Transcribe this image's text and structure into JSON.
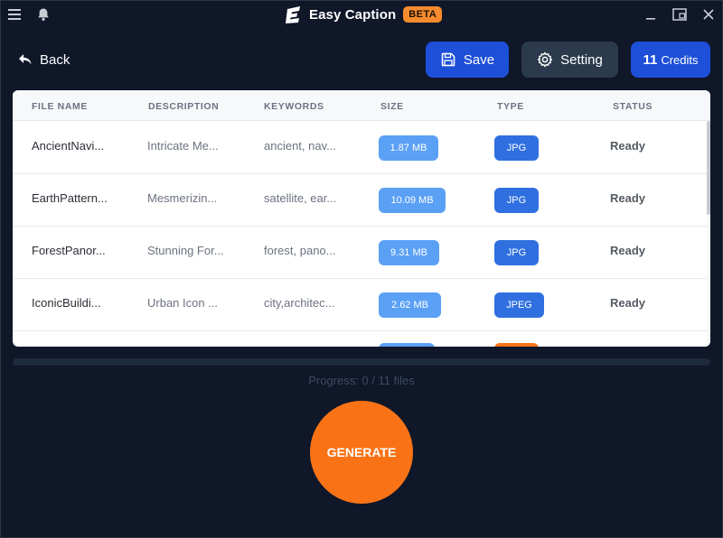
{
  "app": {
    "name": "Easy Caption",
    "badge": "BETA"
  },
  "colors": {
    "background": "#0f1729",
    "primary": "#1d4fd8",
    "accent": "#f97316",
    "secondary_button": "#2c3a4d",
    "size_pill": "#5aa0f5",
    "type_pill": "#2f6fe0"
  },
  "titlebar": {
    "menu_icon": "hamburger-icon",
    "notify_icon": "bell-icon",
    "window_controls": [
      "minimize-icon",
      "restore-icon",
      "close-icon"
    ]
  },
  "toolbar": {
    "back_label": "Back",
    "save_label": "Save",
    "setting_label": "Setting",
    "credits_count": "11",
    "credits_label": "Credits"
  },
  "table": {
    "columns": [
      "FILE NAME",
      "DESCRIPTION",
      "KEYWORDS",
      "SIZE",
      "TYPE",
      "STATUS"
    ],
    "rows": [
      {
        "file_name": "AncientNavi...",
        "description": "Intricate Me...",
        "keywords": "ancient, nav...",
        "size": "1.87 MB",
        "type": "JPG",
        "status": "Ready"
      },
      {
        "file_name": "EarthPattern...",
        "description": "Mesmerizin...",
        "keywords": "satellite, ear...",
        "size": "10.09 MB",
        "type": "JPG",
        "status": "Ready"
      },
      {
        "file_name": "ForestPanor...",
        "description": "Stunning For...",
        "keywords": "forest, pano...",
        "size": "9.31 MB",
        "type": "JPG",
        "status": "Ready"
      },
      {
        "file_name": "IconicBuildi...",
        "description": "Urban Icon ...",
        "keywords": "city,architec...",
        "size": "2.62 MB",
        "type": "JPEG",
        "status": "Ready"
      }
    ]
  },
  "progress": {
    "text": "Progress: 0 / 11 files",
    "done": 0,
    "total": 11
  },
  "generate_label": "GENERATE"
}
